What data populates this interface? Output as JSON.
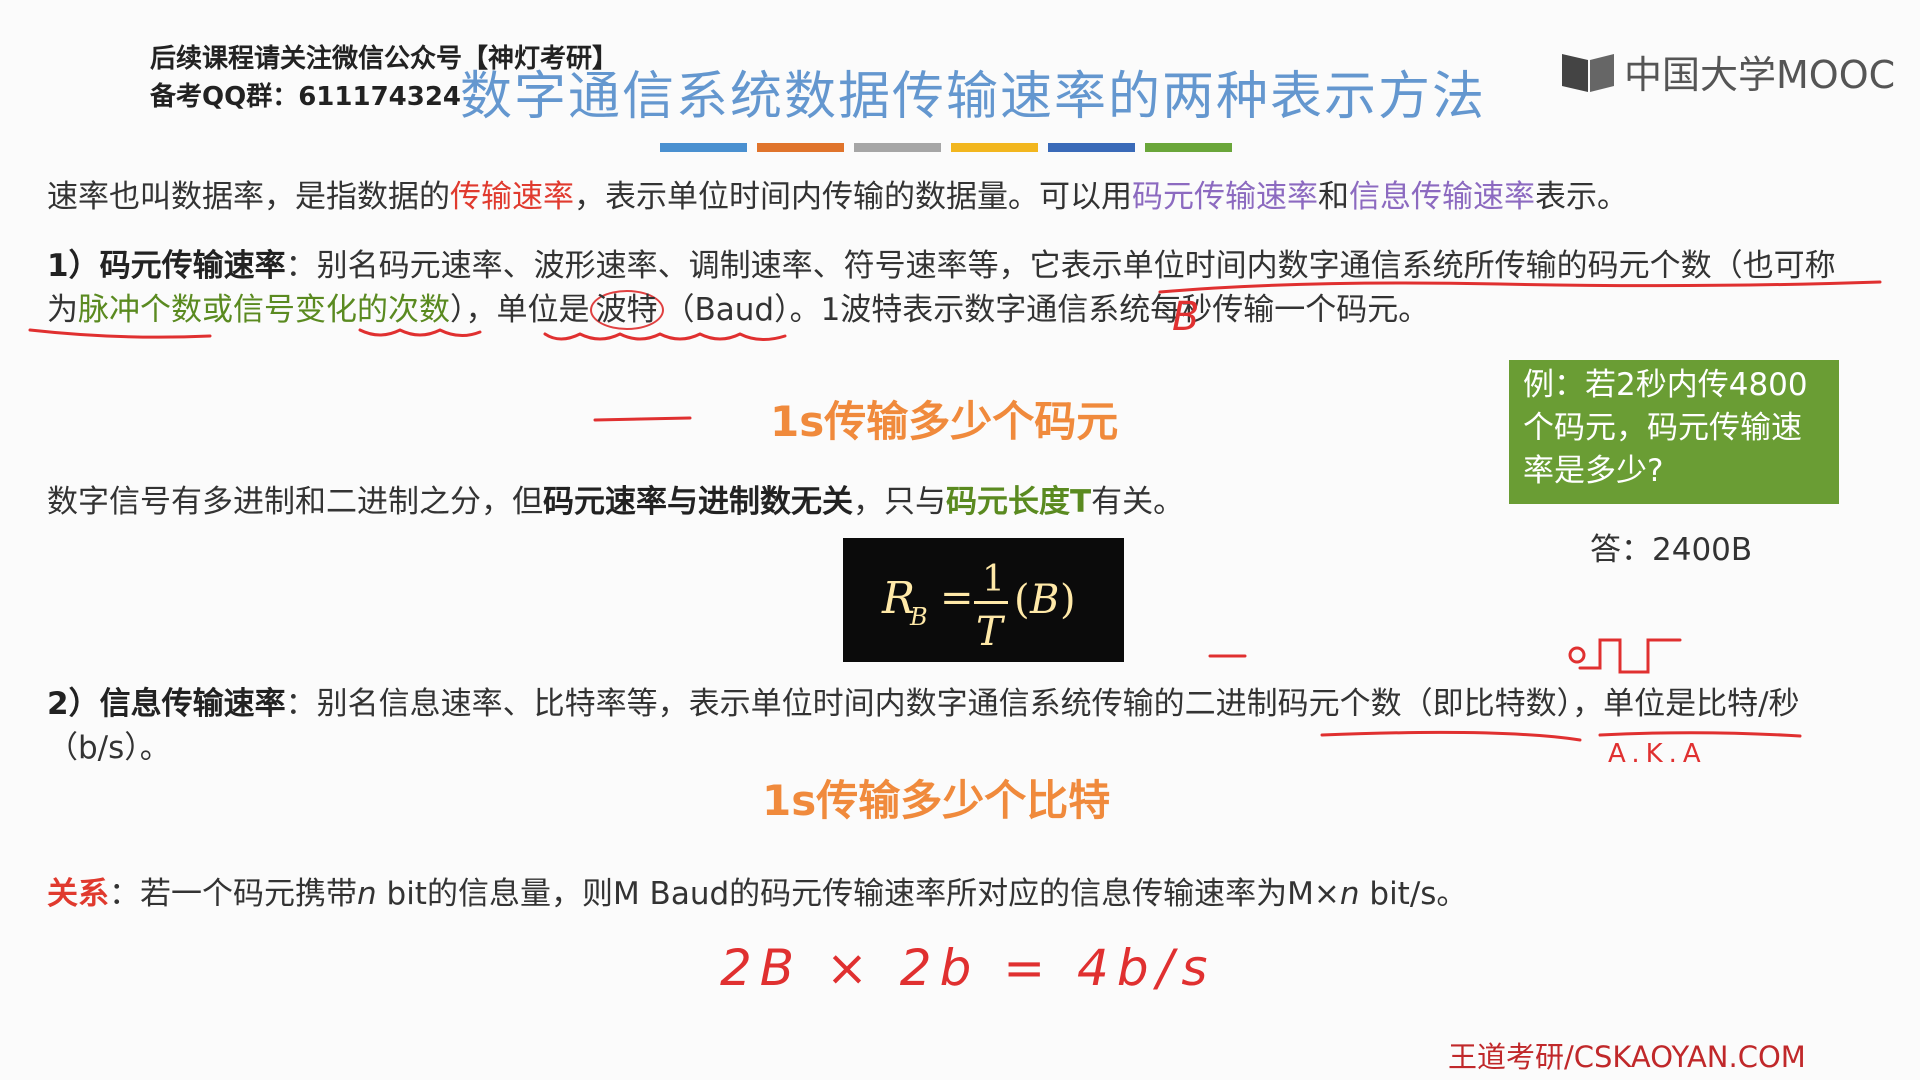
{
  "header": {
    "promo_line1": "后续课程请关注微信公众号【神灯考研】",
    "promo_line2": "备考QQ群：611174324",
    "title": "数字通信系统数据传输速率的两种表示方法",
    "logo_text": "中国大学MOOC",
    "color_bar": [
      "#4a90d0",
      "#e0742c",
      "#a6a6a6",
      "#f2b61e",
      "#3a6ab8",
      "#6aa63a"
    ]
  },
  "intro": {
    "a": "速率也叫数据率，是指数据的",
    "b": "传输速率",
    "c": "，表示单位时间内传输的数据量。可以用",
    "d": "码元传输速率",
    "e": "和",
    "f": "信息传输速率",
    "g": "表示。"
  },
  "section1": {
    "num": "1）",
    "term": "码元传输速率",
    "t1": "：别名码元速率、波形速率、调制速率、符号速率等，它表示单位时间内数字通信系统所传输的码元个数（也可称为",
    "t2": "脉冲个数或信号变化的次数",
    "t3": "），单位是",
    "t4": "波特",
    "t5": "（Baud）。1波特表示数字通信系统每秒传输一个码元。"
  },
  "heading1": "1s传输多少个码元",
  "section_radix": {
    "a": "数字信号有多进制和二进制之分，但",
    "b": "码元速率与进制数无关",
    "c": "，只与",
    "d": "码元长度T",
    "e": "有关。"
  },
  "formula": "R_B = 1/T (B)",
  "example": {
    "question": "例：若2秒内传4800个码元，码元传输速率是多少?",
    "answer": "答：2400B"
  },
  "section2": {
    "num": "2）",
    "term": "信息传输速率",
    "t1": "：别名信息速率、比特率等，表示单位时间内数字通信系统传输的二进制码元个数（即比特数），单位是比特/秒（b/s）。"
  },
  "heading2": "1s传输多少个比特",
  "relation": {
    "label": "关系",
    "a": "：若一个码元携带",
    "n1": "n",
    "b": " bit的信息量，则M Baud的码元传输速率所对应的信息传输速率为M×",
    "n2": "n",
    "c": " bit/s。"
  },
  "handwriting": {
    "equation": "2B × 2b = 4b/s",
    "aka": "A.K.A",
    "b_mark": "B"
  },
  "footer": "王道考研/CSKAOYAN.COM"
}
